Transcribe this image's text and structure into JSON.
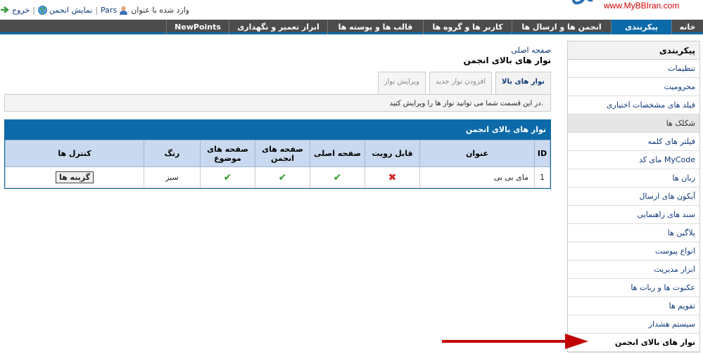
{
  "header": {
    "logo_text": "www.MyBBIran.com",
    "logged_in_label": "وارد شده با عنوان",
    "username": "Pars",
    "view_forum_label": "نمایش انجمن",
    "logout_label": "خروج"
  },
  "menu": [
    {
      "label": "خانه"
    },
    {
      "label": "پیکربندی"
    },
    {
      "label": "انجمن ها و ارسال ها"
    },
    {
      "label": "کاربر ها و گروه ها"
    },
    {
      "label": "قالب ها و پوسته ها"
    },
    {
      "label": "ابزار تعمیر و نگهداری"
    },
    {
      "label": "NewPoints"
    }
  ],
  "sidebar": {
    "title": "پیکربندی",
    "items": [
      {
        "label": "تنظیمات"
      },
      {
        "label": "محرومیت"
      },
      {
        "label": "فیلد های مشخصات اختیاری"
      },
      {
        "label": "شکلک ها"
      },
      {
        "label": "فیلتر های کلمه"
      },
      {
        "label": "مای کد MyCode"
      },
      {
        "label": "زبان ها"
      },
      {
        "label": "آیکون های ارسال"
      },
      {
        "label": "سند های راهنمایی"
      },
      {
        "label": "پلاگین ها"
      },
      {
        "label": "انواع پیوست"
      },
      {
        "label": "ابزار مدیریت"
      },
      {
        "label": "عکبوت ها و ربات ها"
      },
      {
        "label": "تقویم ها"
      },
      {
        "label": "سیستم هشدار"
      },
      {
        "label": "نوار های بالای انجمن"
      }
    ]
  },
  "main": {
    "breadcrumb": "صفحه اصلی",
    "title": "نوار های بالای انجمن",
    "tabs": [
      {
        "label": "نوار های بالا"
      },
      {
        "label": "افزودن نوار جدید"
      },
      {
        "label": "ویرایش نوار"
      }
    ],
    "description": "در این قسمت شما می توانید نوار ها را ویرایش کنید."
  },
  "table": {
    "heading": "نوار های بالای انجمن",
    "columns": [
      "ID",
      "عنوان",
      "قابل رویت",
      "صفحه اصلی",
      "صفحه های انجمن",
      "صفحه های موضوع",
      "رنگ",
      "کنترل ها"
    ],
    "rows": [
      {
        "id": "1",
        "title": "مای بی بی",
        "visible": false,
        "index": true,
        "forum": true,
        "thread": true,
        "color": "سبز",
        "options": "گزینه ها"
      }
    ]
  },
  "colors": {
    "accent": "#0c6aa8",
    "menu_bg": "#4c4c4c",
    "table_header": "#c9d9ef",
    "logo": "#d00000",
    "annotation_arrow": "#c00000"
  }
}
